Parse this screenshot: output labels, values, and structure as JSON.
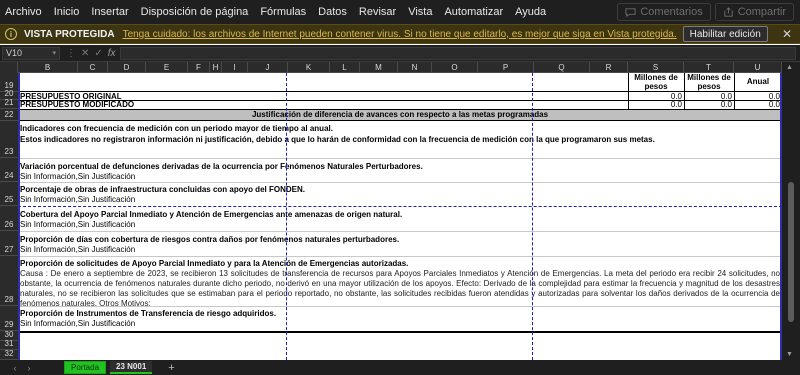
{
  "menu": {
    "items": [
      "Archivo",
      "Inicio",
      "Insertar",
      "Disposición de página",
      "Fórmulas",
      "Datos",
      "Revisar",
      "Vista",
      "Automatizar",
      "Ayuda"
    ],
    "comments_label": "Comentarios",
    "share_label": "Compartir"
  },
  "protected_view": {
    "title": "VISTA PROTEGIDA",
    "message": "Tenga cuidado: los archivos de Internet pueden contener virus. Si no tiene que editarlo, es mejor que siga en Vista protegida.",
    "enable_label": "Habilitar edición",
    "close_glyph": "✕"
  },
  "formula_bar": {
    "name_box": "V10",
    "fx": "fx",
    "cancel": "✕",
    "confirm": "✓",
    "value": ""
  },
  "columns": [
    "B",
    "C",
    "D",
    "E",
    "F",
    "H",
    "I",
    "J",
    "K",
    "L",
    "M",
    "N",
    "O",
    "P",
    "Q",
    "R",
    "S",
    "T",
    "U"
  ],
  "rows": [
    "19",
    "20",
    "21",
    "22",
    "23",
    "24",
    "25",
    "26",
    "27",
    "28",
    "29",
    "30",
    "31",
    "32"
  ],
  "sheet": {
    "unit_s": "Millones de pesos",
    "unit_t": "Millones de pesos",
    "unit_u": "Anual",
    "presupuesto_original": "PRESUPUESTO ORIGINAL",
    "presupuesto_modificado": "PRESUPUESTO MODIFICADO",
    "zero": "0.0",
    "band_title": "Justificación de diferencia de avances con respecto a las metas programadas",
    "ind_line1": "Indicadores con frecuencia de medición con un periodo mayor de tiempo al anual.",
    "ind_line2": "Estos indicadores no registraron información ni justificación, debido a que lo harán de conformidad con la frecuencia de medición con la que programaron sus metas.",
    "var_title": "Variación porcentual de defunciones derivadas de la ocurrencia por Fenómenos Naturales Perturbadores.",
    "sin_info": "Sin Información,Sin Justificación",
    "obras_title": "Porcentaje de obras de infraestructura concluidas con apoyo del FONDEN.",
    "cobertura_title": "Cobertura del Apoyo Parcial Inmediato y Atención de Emergencias ante amenazas de origen natural.",
    "dias_title": "Proporción de días con cobertura de riesgos contra daños por fenómenos naturales perturbadores.",
    "solicitudes_title": "Proporción de solicitudes de Apoyo Parcial Inmediato y para la Atención de Emergencias autorizadas.",
    "causa_text": "Causa : De enero a septiembre de 2023, se recibieron 13 solicitudes de transferencia de recursos para Apoyos Parciales Inmediatos y Atención de Emergencias. La meta del periodo era recibir 24 solicitudes, no obstante, la ocurrencia de fenómenos naturales durante dicho periodo, no derivó en una mayor utilización de los apoyos. Efecto: Derivado de la complejidad para estimar la frecuencia y magnitud de los desastres naturales, no se recibieron las solicitudes que se estimaban para el periodo reportado, no obstante, las solicitudes recibidas fueron atendidas y autorizadas para solventar los daños derivados de la ocurrencia de fenómenos naturales. Otros Motivos:",
    "instrumentos_title": "Proporción de Instrumentos de Transferencia de riesgo adquiridos."
  },
  "tabs": {
    "prev": "‹",
    "next": "›",
    "portada": "Portada",
    "active": "23 N001",
    "add": "+"
  },
  "colors": {
    "protected_bg": "#3d3412",
    "tab_green": "#21c321",
    "page_break": "#1a1acc"
  }
}
